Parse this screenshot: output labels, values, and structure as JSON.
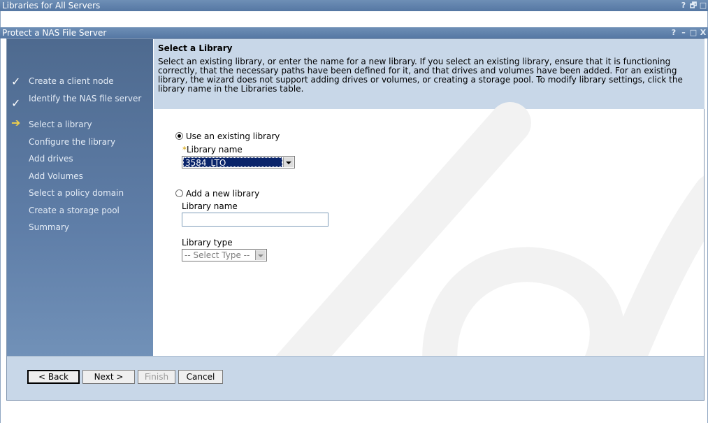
{
  "outer_window": {
    "title": "Libraries for All Servers",
    "controls": [
      "?",
      "🗗",
      "□"
    ]
  },
  "wizard_window": {
    "title": "Protect a NAS File Server",
    "controls": [
      "?",
      "–",
      "□",
      "X"
    ]
  },
  "steps": [
    {
      "label": "Create a client node",
      "status": "done",
      "mark": "✓"
    },
    {
      "label": "Identify the NAS file server",
      "status": "done",
      "mark": "✓"
    },
    {
      "label": "Select a library",
      "status": "current",
      "mark": "➔"
    },
    {
      "label": "Configure the library",
      "status": "pending"
    },
    {
      "label": "Add drives",
      "status": "pending"
    },
    {
      "label": "Add Volumes",
      "status": "pending"
    },
    {
      "label": "Select a policy domain",
      "status": "pending"
    },
    {
      "label": "Create a storage pool",
      "status": "pending"
    },
    {
      "label": "Summary",
      "status": "pending"
    }
  ],
  "content": {
    "title": "Select a Library",
    "description": "Select an existing library, or enter the name for a new library. If you select an existing library, ensure that it is functioning correctly, that the necessary paths have been defined for it, and that drives and volumes have been added. For an existing library, the wizard does not support adding drives or volumes, or creating a storage pool. To modify library settings, click the library name in the Libraries table.",
    "use_existing": {
      "label": "Use an existing library",
      "checked": true,
      "required_mark": "*",
      "name_label": "Library name",
      "selected_value": "3584_LTO"
    },
    "add_new": {
      "label": "Add a new library",
      "checked": false,
      "name_label": "Library name",
      "name_value": "",
      "type_label": "Library type",
      "type_value": "-- Select Type --"
    }
  },
  "buttons": {
    "back": "< Back",
    "next": "Next >",
    "finish": "Finish",
    "cancel": "Cancel"
  },
  "colors": {
    "titlebar": "#5f80ab",
    "steps_panel": "#5f7ea8",
    "description_bg": "#c8d7e8",
    "selection": "#0a246a",
    "current_step_arrow": "#f2d14a"
  }
}
